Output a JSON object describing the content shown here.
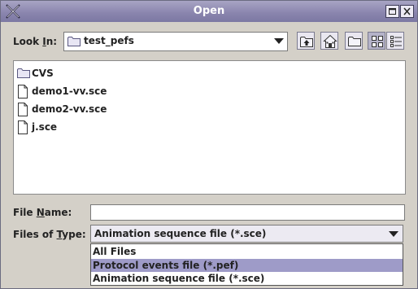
{
  "window": {
    "title": "Open"
  },
  "look_in": {
    "label_before": "Look ",
    "label_mnemonic": "I",
    "label_after": "n:",
    "value": "test_pefs"
  },
  "files": [
    {
      "name": "CVS",
      "icon": "folder-icon"
    },
    {
      "name": "demo1-vv.sce",
      "icon": "file-icon"
    },
    {
      "name": "demo2-vv.sce",
      "icon": "file-icon"
    },
    {
      "name": "j.sce",
      "icon": "file-icon"
    }
  ],
  "file_name": {
    "label_before": "File ",
    "label_mnemonic": "N",
    "label_after": "ame:",
    "value": ""
  },
  "file_type": {
    "label_before": "Files of ",
    "label_mnemonic": "T",
    "label_after": "ype:",
    "selected": "Animation sequence file (*.sce)",
    "options": [
      "All Files",
      "Protocol events file (*.pef)",
      "Animation sequence file (*.sce)"
    ],
    "highlighted_option": "Protocol events file (*.pef)"
  },
  "colors": {
    "titlebar": "#8984ad",
    "highlight": "#9e9bc8",
    "background": "#d4d0c8"
  }
}
